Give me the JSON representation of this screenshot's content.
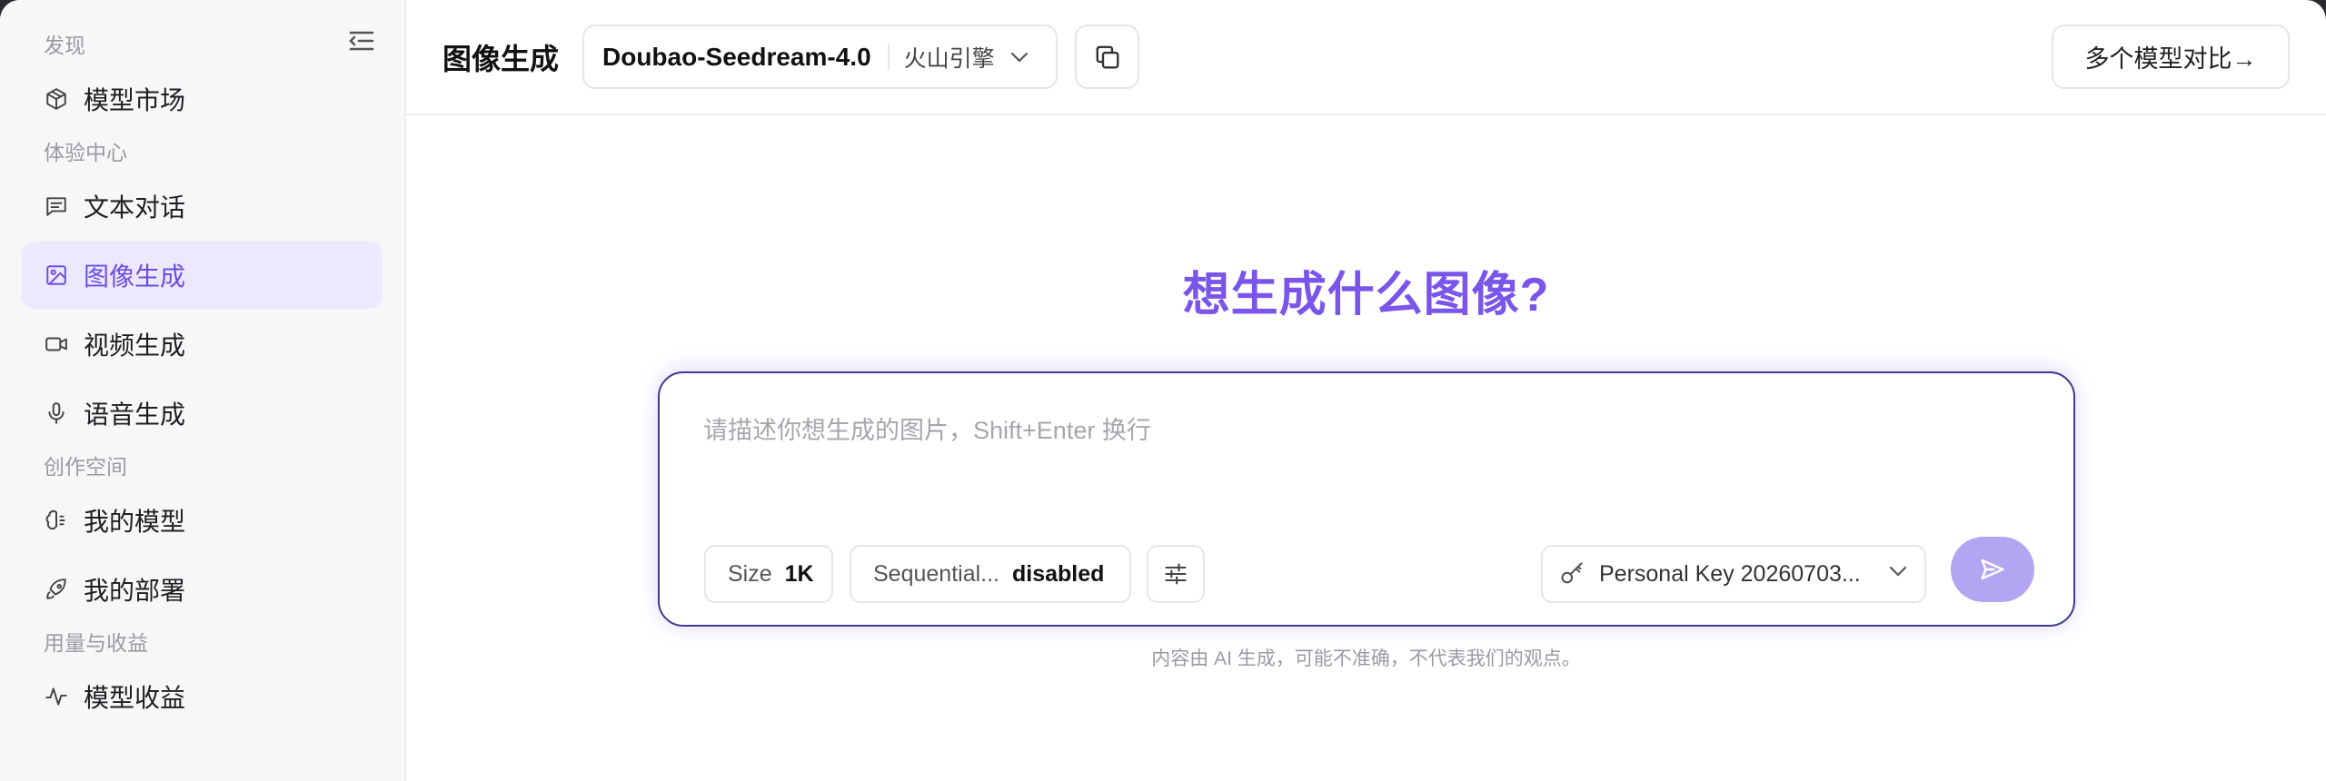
{
  "sidebar": {
    "sections": {
      "discover": "发现",
      "experience": "体验中心",
      "create": "创作空间",
      "usage": "用量与收益"
    },
    "items": {
      "model_market": "模型市场",
      "text_chat": "文本对话",
      "image_gen": "图像生成",
      "video_gen": "视频生成",
      "voice_gen": "语音生成",
      "my_models": "我的模型",
      "my_deploy": "我的部署",
      "model_revenue": "模型收益"
    },
    "active_item": "图像生成",
    "accent_color": "#6b4fe0"
  },
  "header": {
    "title": "图像生成",
    "model": {
      "name": "Doubao-Seedream-4.0",
      "provider": "火山引擎"
    },
    "compare_label": "多个模型对比→"
  },
  "main": {
    "hero": "想生成什么图像?",
    "prompt": {
      "placeholder": "请描述你想生成的图片，Shift+Enter 换行",
      "value": ""
    },
    "options": {
      "size_key": "Size",
      "size_value": "1K",
      "seq_key": "Sequential...",
      "seq_value": "disabled"
    },
    "api_key": "Personal Key 20260703...",
    "disclaimer": "内容由 AI 生成，可能不准确，不代表我们的观点。"
  },
  "icons": {
    "sidebar_toggle": "collapse-menu-icon",
    "model_market": "package-icon",
    "text_chat": "message-square-icon",
    "image_gen": "image-icon",
    "video_gen": "video-icon",
    "voice_gen": "mic-icon",
    "my_models": "brain-icon",
    "my_deploy": "rocket-icon",
    "model_revenue": "activity-icon",
    "copy": "copy-icon",
    "settings": "sliders-icon",
    "key": "key-icon",
    "send": "send-icon",
    "chevron": "chevron-down-icon"
  },
  "colors": {
    "hero": "#7a55ea",
    "send_button": "#b4a5f3",
    "prompt_border": "#3e3a8f"
  }
}
